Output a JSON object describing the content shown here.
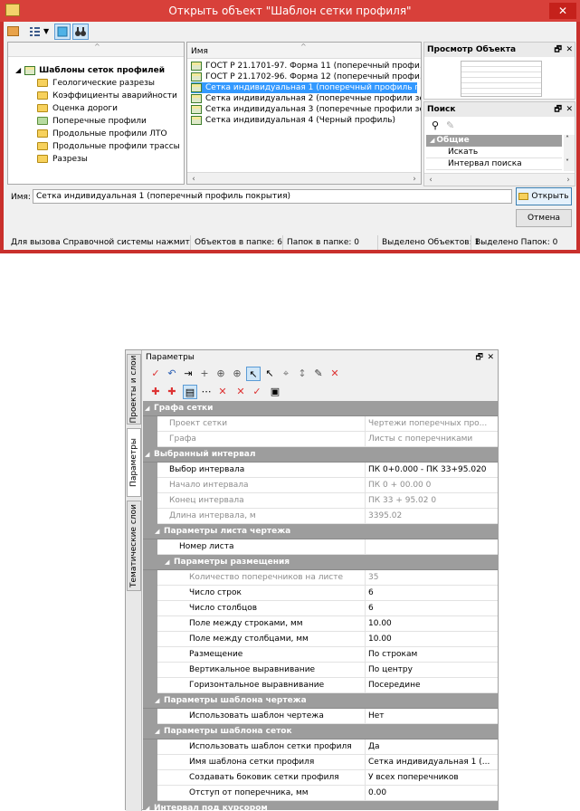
{
  "dialog": {
    "title": "Открыть объект \"Шаблон сетки профиля\"",
    "close": "✕",
    "tree": {
      "root": "Шаблоны сеток профилей",
      "items": [
        "Геологические разрезы",
        "Коэффициенты аварийности",
        "Оценка дороги",
        "Поперечные профили",
        "Продольные профили ЛТО",
        "Продольные профили трассы",
        "Разрезы"
      ]
    },
    "list": {
      "header": "Имя",
      "items": [
        "ГОСТ Р 21.1701-97. Форма 11 (поперечный профи...",
        "ГОСТ Р 21.1702-96. Форма 12 (поперечный профи...",
        "Сетка индивидуальная 1 (поперечный профиль по...",
        "Сетка индивидуальная 2 (поперечные профили зе...",
        "Сетка индивидуальная 3 (поперечные профили зе...",
        "Сетка индивидуальная 4 (Черный профиль)"
      ],
      "selected_index": 2
    },
    "preview": {
      "title": "Просмотр Объекта",
      "pin": "🗗",
      "close": "✕"
    },
    "search": {
      "title": "Поиск",
      "pin": "🗗",
      "close": "✕",
      "category": "Общие",
      "rows": [
        "Искать",
        "Интервал поиска"
      ]
    },
    "name_label": "Имя:",
    "name_value": "Сетка индивидуальная 1 (поперечный профиль покрытия)",
    "open_button": "Открыть",
    "cancel_button": "Отмена",
    "status": [
      "Для вызова Справочной системы нажмит",
      "Объектов в папке: 6",
      "Папок в папке: 0",
      "Выделено Объектов: 1",
      "Выделено Папок: 0"
    ]
  },
  "params": {
    "title": "Параметры",
    "pin": "🗗",
    "close": "✕",
    "vtabs": [
      "Проекты и слои",
      "Параметры",
      "Тематические слои"
    ],
    "rows": [
      {
        "type": "cat",
        "level": 0,
        "label": "Графа сетки"
      },
      {
        "type": "row",
        "level": 1,
        "label": "Проект сетки",
        "value": "Чертежи поперечных про...",
        "disabled": true
      },
      {
        "type": "row",
        "level": 1,
        "label": "Графа",
        "value": "Листы с поперечниками",
        "disabled": true
      },
      {
        "type": "cat",
        "level": 0,
        "label": "Выбранный интервал"
      },
      {
        "type": "row",
        "level": 1,
        "label": "Выбор интервала",
        "value": "ПК 0+0.000 - ПК 33+95.020",
        "disabled": false
      },
      {
        "type": "row",
        "level": 1,
        "label": "Начало интервала",
        "value": "ПК    0 + 00.00  0",
        "disabled": true
      },
      {
        "type": "row",
        "level": 1,
        "label": "Конец интервала",
        "value": "ПК    33 + 95.02  0",
        "disabled": true
      },
      {
        "type": "row",
        "level": 1,
        "label": "Длина интервала, м",
        "value": "3395.02",
        "disabled": true
      },
      {
        "type": "cat",
        "level": 1,
        "label": "Параметры листа чертежа"
      },
      {
        "type": "row",
        "level": 2,
        "label": "Номер листа",
        "value": "",
        "disabled": false
      },
      {
        "type": "cat",
        "level": 2,
        "label": "Параметры размещения"
      },
      {
        "type": "row",
        "level": 3,
        "label": "Количество поперечников на листе",
        "value": "35",
        "disabled": true
      },
      {
        "type": "row",
        "level": 3,
        "label": "Число строк",
        "value": "6",
        "disabled": false
      },
      {
        "type": "row",
        "level": 3,
        "label": "Число столбцов",
        "value": "6",
        "disabled": false
      },
      {
        "type": "row",
        "level": 3,
        "label": "Поле между строками, мм",
        "value": "10.00",
        "disabled": false
      },
      {
        "type": "row",
        "level": 3,
        "label": "Поле между столбцами, мм",
        "value": "10.00",
        "disabled": false
      },
      {
        "type": "row",
        "level": 3,
        "label": "Размещение",
        "value": "По строкам",
        "disabled": false
      },
      {
        "type": "row",
        "level": 3,
        "label": "Вертикальное выравнивание",
        "value": "По центру",
        "disabled": false
      },
      {
        "type": "row",
        "level": 3,
        "label": "Горизонтальное выравнивание",
        "value": "Посередине",
        "disabled": false
      },
      {
        "type": "cat",
        "level": 1,
        "label": "Параметры шаблона чертежа"
      },
      {
        "type": "row",
        "level": 3,
        "label": "Использовать шаблон чертежа",
        "value": "Нет",
        "disabled": false
      },
      {
        "type": "cat",
        "level": 1,
        "label": "Параметры шаблона сеток"
      },
      {
        "type": "row",
        "level": 3,
        "label": "Использовать шаблон сетки профиля",
        "value": "Да",
        "disabled": false
      },
      {
        "type": "row",
        "level": 3,
        "label": "Имя шаблона сетки профиля",
        "value": "Сетка индивидуальная 1 (...",
        "disabled": false
      },
      {
        "type": "row",
        "level": 3,
        "label": "Создавать боковик сетки профиля",
        "value": "У всех поперечников",
        "disabled": false
      },
      {
        "type": "row",
        "level": 3,
        "label": "Отступ от поперечника, мм",
        "value": "0.00",
        "disabled": false
      },
      {
        "type": "cat",
        "level": 0,
        "label": "Интервал под курсором"
      }
    ]
  },
  "colors": {
    "title_bar": "#d8403a",
    "selection": "#3399ff",
    "category": "#9d9d9d"
  }
}
